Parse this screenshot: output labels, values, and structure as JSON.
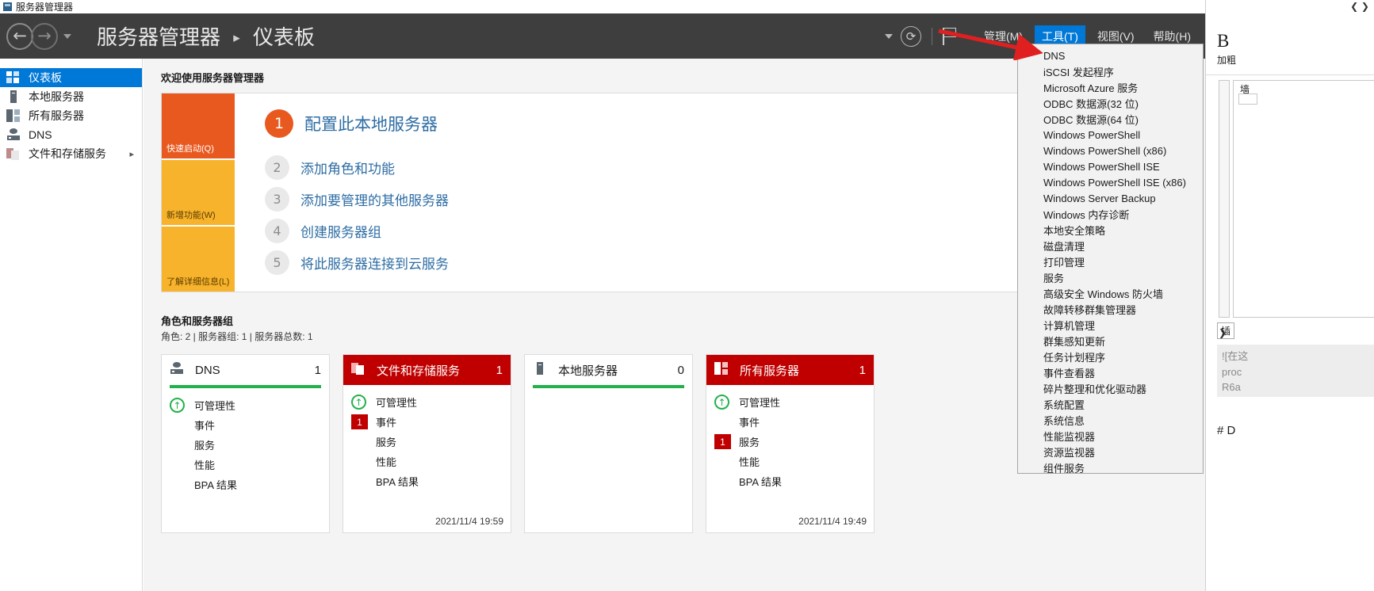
{
  "window": {
    "title": "服务器管理器",
    "controls": {
      "minimize": "—",
      "maximize": "❐",
      "close": "✕"
    }
  },
  "command_bar": {
    "back_icon": "←",
    "forward_icon": "→",
    "breadcrumb_root": "服务器管理器",
    "breadcrumb_separator": "▸",
    "breadcrumb_current": "仪表板",
    "refresh_icon": "⟳",
    "flag_icon": "flag-icon",
    "menus": [
      {
        "label": "管理(M)",
        "active": false
      },
      {
        "label": "工具(T)",
        "active": true
      },
      {
        "label": "视图(V)",
        "active": false
      },
      {
        "label": "帮助(H)",
        "active": false
      }
    ]
  },
  "sidebar": {
    "items": [
      {
        "label": "仪表板",
        "selected": true,
        "icon": "dashboard-icon",
        "expandable": false
      },
      {
        "label": "本地服务器",
        "selected": false,
        "icon": "server-icon",
        "expandable": false
      },
      {
        "label": "所有服务器",
        "selected": false,
        "icon": "servers-icon",
        "expandable": false
      },
      {
        "label": "DNS",
        "selected": false,
        "icon": "dns-icon",
        "expandable": false
      },
      {
        "label": "文件和存储服务",
        "selected": false,
        "icon": "storage-icon",
        "expandable": true,
        "chevron": "▸"
      }
    ]
  },
  "welcome": {
    "title": "欢迎使用服务器管理器",
    "tiles": [
      {
        "label": "快速启动(Q)",
        "color": "#e8591f"
      },
      {
        "label": "新增功能(W)",
        "color": "#f7b32b"
      },
      {
        "label": "了解详细信息(L)",
        "color": "#f7b32b"
      }
    ],
    "steps": [
      {
        "num": "1",
        "label": "配置此本地服务器",
        "primary": true
      },
      {
        "num": "2",
        "label": "添加角色和功能",
        "primary": false
      },
      {
        "num": "3",
        "label": "添加要管理的其他服务器",
        "primary": false
      },
      {
        "num": "4",
        "label": "创建服务器组",
        "primary": false
      },
      {
        "num": "5",
        "label": "将此服务器连接到云服务",
        "primary": false
      }
    ]
  },
  "roles": {
    "title": "角色和服务器组",
    "subtitle": "角色: 2 | 服务器组: 1 | 服务器总数: 1",
    "cards": [
      {
        "title": "DNS",
        "count": "1",
        "style": "plain",
        "icon": "dns-icon",
        "accent": "#22b14c",
        "rows": [
          {
            "label": "可管理性",
            "badge": "ok"
          },
          {
            "label": "事件",
            "badge": "none"
          },
          {
            "label": "服务",
            "badge": "none"
          },
          {
            "label": "性能",
            "badge": "none"
          },
          {
            "label": "BPA 结果",
            "badge": "none"
          }
        ],
        "timestamp": ""
      },
      {
        "title": "文件和存储服务",
        "count": "1",
        "style": "red",
        "icon": "storage-icon",
        "accent": "#c00000",
        "rows": [
          {
            "label": "可管理性",
            "badge": "ok"
          },
          {
            "label": "事件",
            "badge": "num",
            "badge_value": "1"
          },
          {
            "label": "服务",
            "badge": "none"
          },
          {
            "label": "性能",
            "badge": "none"
          },
          {
            "label": "BPA 结果",
            "badge": "none"
          }
        ],
        "timestamp": "2021/11/4 19:59"
      },
      {
        "title": "本地服务器",
        "count": "0",
        "style": "plain",
        "icon": "server-icon",
        "accent": "#22b14c",
        "rows": [],
        "timestamp": ""
      },
      {
        "title": "所有服务器",
        "count": "1",
        "style": "red",
        "icon": "servers-icon",
        "accent": "#c00000",
        "rows": [
          {
            "label": "可管理性",
            "badge": "ok"
          },
          {
            "label": "事件",
            "badge": "none"
          },
          {
            "label": "服务",
            "badge": "num",
            "badge_value": "1"
          },
          {
            "label": "性能",
            "badge": "none"
          },
          {
            "label": "BPA 结果",
            "badge": "none"
          }
        ],
        "timestamp": "2021/11/4 19:49"
      }
    ]
  },
  "tools_menu": {
    "items": [
      "DNS",
      "iSCSI 发起程序",
      "Microsoft Azure 服务",
      "ODBC 数据源(32 位)",
      "ODBC 数据源(64 位)",
      "Windows PowerShell",
      "Windows PowerShell (x86)",
      "Windows PowerShell ISE",
      "Windows PowerShell ISE (x86)",
      "Windows Server Backup",
      "Windows 内存诊断",
      "本地安全策略",
      "磁盘清理",
      "打印管理",
      "服务",
      "高级安全 Windows 防火墙",
      "故障转移群集管理器",
      "计算机管理",
      "群集感知更新",
      "任务计划程序",
      "事件查看器",
      "碎片整理和优化驱动器",
      "系统配置",
      "系统信息",
      "性能监视器",
      "资源监视器",
      "组件服务"
    ]
  },
  "right_pane": {
    "nav_glyph": "❮ ❯",
    "bold_glyph": "B",
    "bold_label": "加粗",
    "panel_text": "墙",
    "foot_chevron": "❯",
    "foot_box": "插",
    "grey_lines": [
      "![在这",
      "proc",
      "R6a"
    ],
    "hash_text": "# D"
  }
}
